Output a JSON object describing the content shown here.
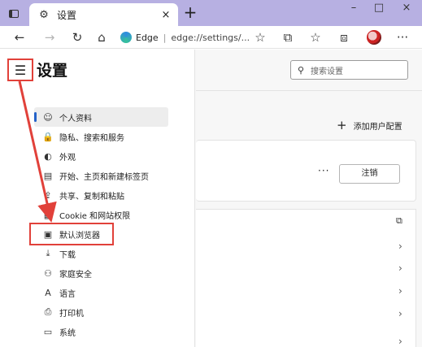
{
  "window": {
    "tab_title": "设置",
    "tab_close": "×",
    "new_tab": "+",
    "minimize": "–",
    "maximize": "□",
    "close": "×"
  },
  "toolbar": {
    "back": "←",
    "forward": "→",
    "refresh": "↻",
    "home": "⌂",
    "address_label": "Edge",
    "address_sep": "|",
    "address_url": "edge://settings/...",
    "more": "···"
  },
  "settings": {
    "menu_icon": "☰",
    "title": "设置",
    "search_icon": "⚲",
    "search_placeholder": "搜索设置",
    "nav": [
      {
        "icon": "☺",
        "label": "个人资料",
        "name": "profile"
      },
      {
        "icon": "🔒",
        "label": "隐私、搜索和服务",
        "name": "privacy"
      },
      {
        "icon": "◐",
        "label": "外观",
        "name": "appearance"
      },
      {
        "icon": "▤",
        "label": "开始、主页和新建标签页",
        "name": "start-home"
      },
      {
        "icon": "⇪",
        "label": "共享、复制和粘贴",
        "name": "share-copy"
      },
      {
        "icon": "▦",
        "label": "Cookie 和网站权限",
        "name": "cookies"
      },
      {
        "icon": "▣",
        "label": "默认浏览器",
        "name": "default-browser"
      },
      {
        "icon": "⤓",
        "label": "下载",
        "name": "downloads"
      },
      {
        "icon": "⚇",
        "label": "家庭安全",
        "name": "family"
      },
      {
        "icon": "A",
        "label": "语言",
        "name": "languages"
      },
      {
        "icon": "⎙",
        "label": "打印机",
        "name": "printers"
      },
      {
        "icon": "▭",
        "label": "系统",
        "name": "system"
      }
    ],
    "add_profile_icon": "+",
    "add_profile": "添加用户配置",
    "profile_more": "···",
    "sign_out": "注销",
    "external_icon": "⧉",
    "chevron": "›"
  },
  "colors": {
    "titlebar": "#b7b0e2",
    "annotation_red": "#e1413a",
    "active_indicator": "#2563c9"
  }
}
